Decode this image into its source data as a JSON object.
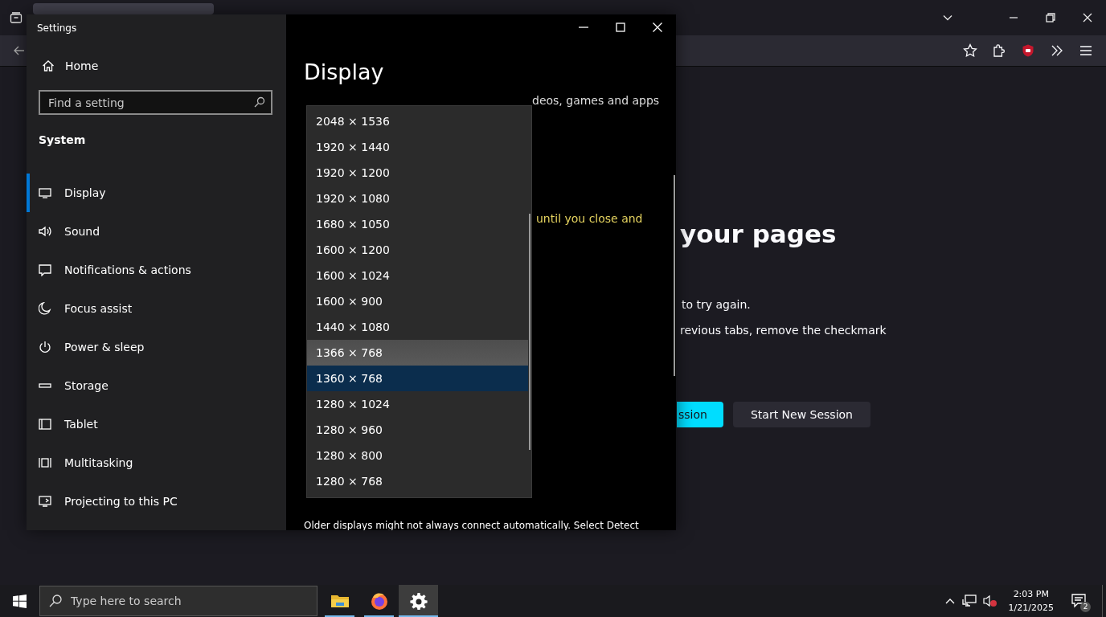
{
  "browser": {
    "content": {
      "heading": "your pages",
      "lines": [
        "to try again.",
        "revious tabs, remove the checkmark"
      ],
      "buttons": [
        {
          "label": "ssion",
          "kind": "primary"
        },
        {
          "label": "Start New Session",
          "kind": "secondary"
        }
      ]
    }
  },
  "settings": {
    "title": "Settings",
    "home": "Home",
    "search": {
      "placeholder": "Find a setting"
    },
    "section": "System",
    "nav": [
      {
        "label": "Display",
        "selected": true
      },
      {
        "label": "Sound",
        "selected": false
      },
      {
        "label": "Notifications & actions",
        "selected": false
      },
      {
        "label": "Focus assist",
        "selected": false
      },
      {
        "label": "Power & sleep",
        "selected": false
      },
      {
        "label": "Storage",
        "selected": false
      },
      {
        "label": "Tablet",
        "selected": false
      },
      {
        "label": "Multitasking",
        "selected": false
      },
      {
        "label": "Projecting to this PC",
        "selected": false
      }
    ],
    "page_title": "Display",
    "fragments": [
      {
        "text": "deos, games and apps",
        "kind": "normal"
      },
      {
        "text": "until you close and",
        "kind": "warning"
      }
    ],
    "footer_text": "Older displays might not always connect automatically. Select Detect",
    "resolutions": [
      {
        "label": "2048 × 1536",
        "hovered": false,
        "selected": false
      },
      {
        "label": "1920 × 1440",
        "hovered": false,
        "selected": false
      },
      {
        "label": "1920 × 1200",
        "hovered": false,
        "selected": false
      },
      {
        "label": "1920 × 1080",
        "hovered": false,
        "selected": false
      },
      {
        "label": "1680 × 1050",
        "hovered": false,
        "selected": false
      },
      {
        "label": "1600 × 1200",
        "hovered": false,
        "selected": false
      },
      {
        "label": "1600 × 1024",
        "hovered": false,
        "selected": false
      },
      {
        "label": "1600 × 900",
        "hovered": false,
        "selected": false
      },
      {
        "label": "1440 × 1080",
        "hovered": false,
        "selected": false
      },
      {
        "label": "1366 × 768",
        "hovered": true,
        "selected": false
      },
      {
        "label": "1360 × 768",
        "hovered": false,
        "selected": true
      },
      {
        "label": "1280 × 1024",
        "hovered": false,
        "selected": false
      },
      {
        "label": "1280 × 960",
        "hovered": false,
        "selected": false
      },
      {
        "label": "1280 × 800",
        "hovered": false,
        "selected": false
      },
      {
        "label": "1280 × 768",
        "hovered": false,
        "selected": false
      }
    ]
  },
  "taskbar": {
    "search": {
      "placeholder": "Type here to search"
    },
    "apps": [
      {
        "kind": "folder",
        "active": false
      },
      {
        "kind": "firefox",
        "active": false
      },
      {
        "kind": "settings",
        "active": true
      }
    ],
    "time": "2:03 PM",
    "date": "1/21/2025",
    "notification_count": "2"
  }
}
